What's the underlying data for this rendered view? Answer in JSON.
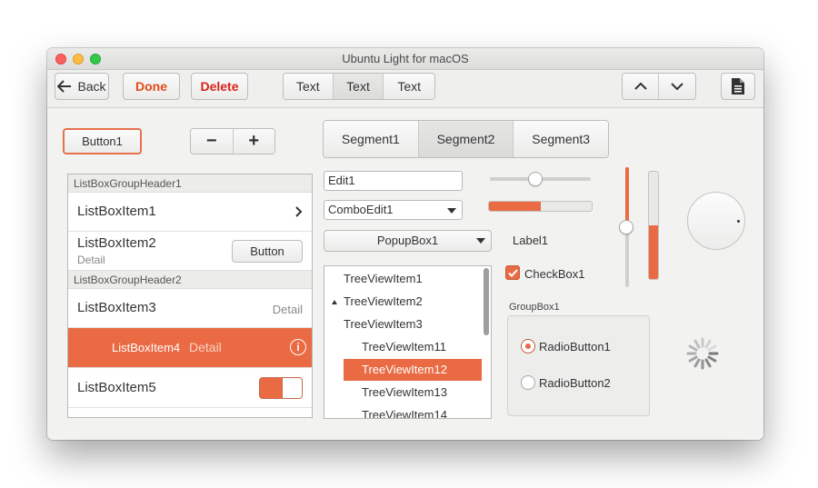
{
  "window": {
    "title": "Ubuntu Light for macOS"
  },
  "toolbar": {
    "back_label": "Back",
    "done_label": "Done",
    "delete_label": "Delete",
    "text_segments": [
      "Text",
      "Text",
      "Text"
    ],
    "up_icon": "chevron-up-icon",
    "down_icon": "chevron-down-icon",
    "doc_icon": "document-icon"
  },
  "controls": {
    "button1": "Button1",
    "stepper_minus": "−",
    "stepper_plus": "+",
    "segments": [
      "Segment1",
      "Segment2",
      "Segment3"
    ],
    "segments_selected": 1,
    "edit_value": "Edit1",
    "combo_value": "ComboEdit1",
    "popup_value": "PopupBox1",
    "label1": "Label1",
    "checkbox_label": "CheckBox1",
    "checkbox_checked": true,
    "groupbox_title": "GroupBox1",
    "radio1": "RadioButton1",
    "radio2": "RadioButton2",
    "radio_selected": 0,
    "hslider_value": 0.45,
    "hprogress_value": 0.5,
    "vslider_value": 0.5,
    "vprogress_value": 0.5
  },
  "listbox": {
    "header1": "ListBoxGroupHeader1",
    "item1": "ListBoxItem1",
    "item2": "ListBoxItem2",
    "item2_detail": "Detail",
    "item2_button": "Button",
    "header2": "ListBoxGroupHeader2",
    "item3": "ListBoxItem3",
    "item3_detail": "Detail",
    "item4": "ListBoxItem4",
    "item4_detail": "Detail",
    "item5": "ListBoxItem5"
  },
  "tree": {
    "items": [
      "TreeViewItem1",
      "TreeViewItem2",
      "TreeViewItem3",
      "TreeViewItem11",
      "TreeViewItem12",
      "TreeViewItem13",
      "TreeViewItem14"
    ],
    "selected": "TreeViewItem12"
  },
  "colors": {
    "accent": "#e96a43",
    "window_bg": "#f2f2f1"
  }
}
